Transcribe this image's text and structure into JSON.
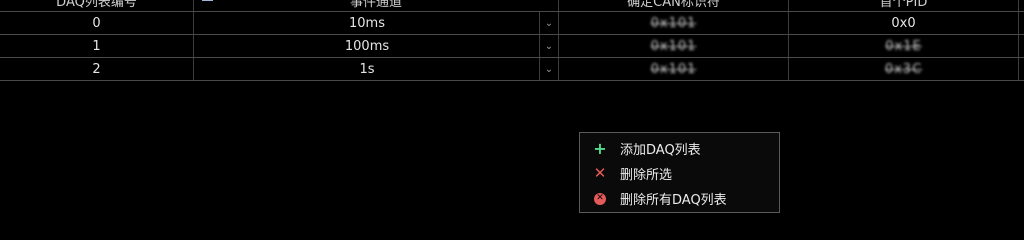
{
  "table": {
    "headers": [
      "DAQ列表编号",
      "事件通道",
      "确定CAN标识符",
      "首个PID"
    ],
    "rows": [
      {
        "index": "0",
        "channel": "10ms",
        "can_id": "0x101",
        "pid": "0x0"
      },
      {
        "index": "1",
        "channel": "100ms",
        "can_id": "0x101",
        "pid": "0x1E"
      },
      {
        "index": "2",
        "channel": "1s",
        "can_id": "0x101",
        "pid": "0x3C"
      }
    ]
  },
  "context_menu": {
    "items": [
      {
        "label": "添加DAQ列表",
        "icon": "plus-icon",
        "color": "#56d98a"
      },
      {
        "label": "删除所选",
        "icon": "cross-icon",
        "color": "#e25a5a"
      },
      {
        "label": "删除所有DAQ列表",
        "icon": "circle-x-icon",
        "color": "#e25a5a"
      }
    ]
  }
}
